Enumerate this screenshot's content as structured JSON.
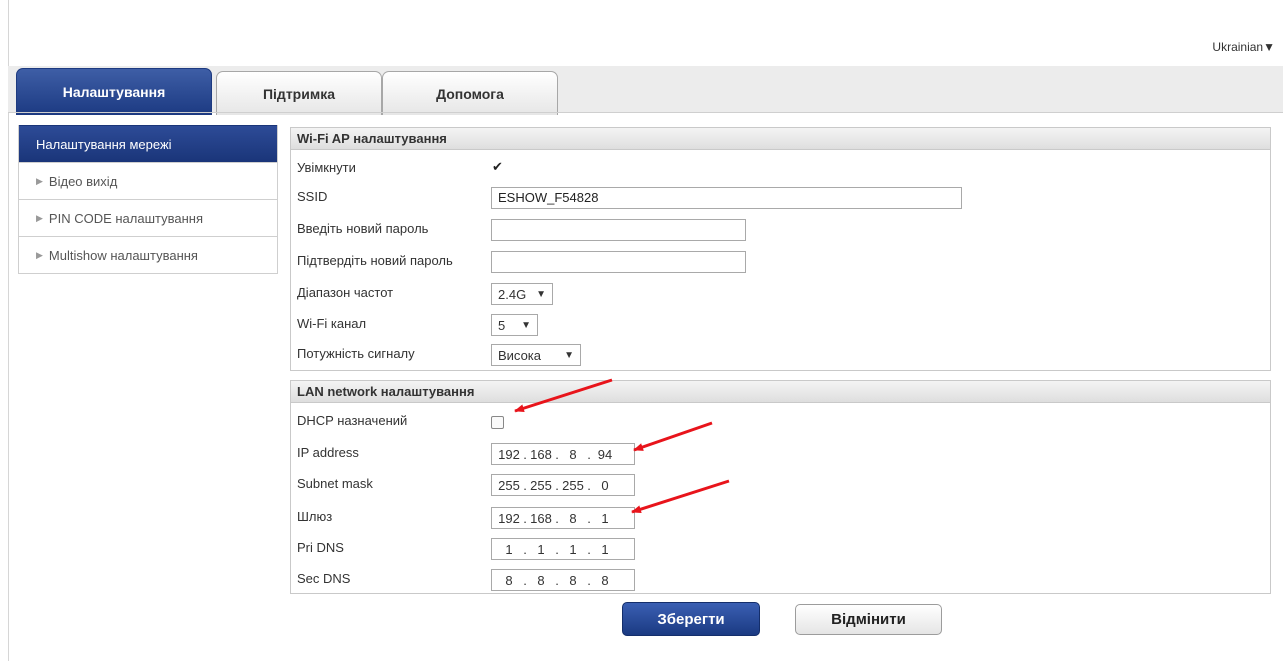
{
  "language": {
    "label": "Ukrainian",
    "caret": "▼"
  },
  "tabs": [
    {
      "label": "Налаштування"
    },
    {
      "label": "Підтримка"
    },
    {
      "label": "Допомога"
    }
  ],
  "sidebar": {
    "items": [
      {
        "label": "Налаштування мережі"
      },
      {
        "label": "Відео вихід"
      },
      {
        "label": "PIN CODE налаштування"
      },
      {
        "label": "Multishow налаштування"
      }
    ]
  },
  "wifi": {
    "title": "Wi-Fi AP налаштування",
    "enable_label": "Увімкнути",
    "enable_checked": true,
    "ssid_label": "SSID",
    "ssid_value": "ESHOW_F54828",
    "new_password_label": "Введіть новий пароль",
    "confirm_password_label": "Підтвердіть новий пароль",
    "band_label": "Діапазон частот",
    "band_value": "2.4G",
    "channel_label": "Wi-Fi канал",
    "channel_value": "5",
    "power_label": "Потужність сигналу",
    "power_value": "Висока"
  },
  "lan": {
    "title": "LAN network налаштування",
    "dhcp_label": "DHCP назначений",
    "dhcp_checked": false,
    "ip_label": "IP address",
    "ip": [
      "192",
      "168",
      "8",
      "94"
    ],
    "mask_label": "Subnet mask",
    "mask": [
      "255",
      "255",
      "255",
      "0"
    ],
    "gateway_label": "Шлюз",
    "gateway": [
      "192",
      "168",
      "8",
      "1"
    ],
    "pri_dns_label": "Pri DNS",
    "pri_dns": [
      "1",
      "1",
      "1",
      "1"
    ],
    "sec_dns_label": "Sec DNS",
    "sec_dns": [
      "8",
      "8",
      "8",
      "8"
    ]
  },
  "buttons": {
    "save": "Зберегти",
    "cancel": "Відмінити"
  },
  "colors": {
    "accent": "#1c3a82",
    "annotation": "#e8141b"
  },
  "icons": {
    "checkmark": "check-icon",
    "dropdown": "chevron-down-icon",
    "sidebar_bullet": "triangle-right-icon"
  }
}
